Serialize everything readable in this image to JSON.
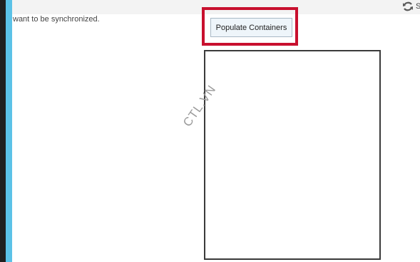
{
  "description": "want to be synchronized.",
  "top_bar": {
    "icon": "sync-icon",
    "truncated_label": "S"
  },
  "populate_button": {
    "label": "Populate Containers"
  },
  "watermark": "CTL.VN",
  "colors": {
    "accent_bar": "#5bc2e7",
    "highlight_border": "#c8102e",
    "button_background": "#eef5fa"
  }
}
